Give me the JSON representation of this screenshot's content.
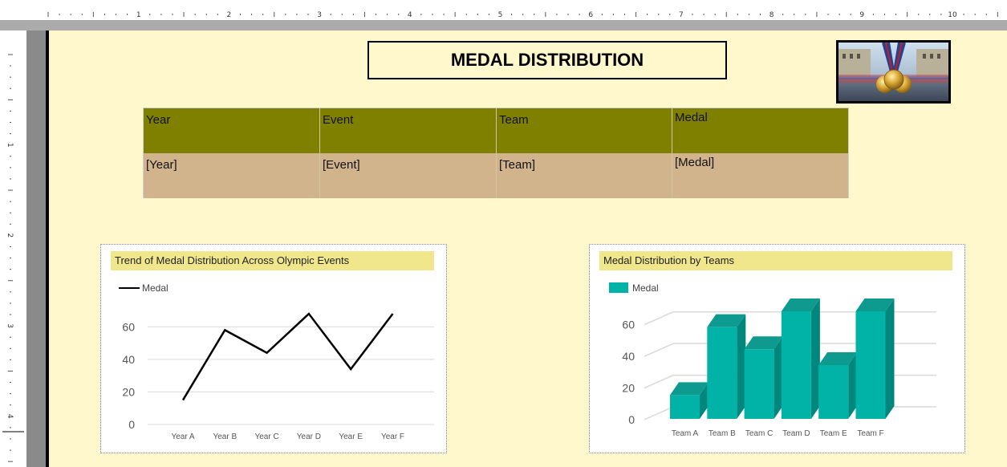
{
  "report": {
    "title": "MEDAL DISTRIBUTION"
  },
  "ruler": {
    "top_numbers": [
      "1",
      "2",
      "3",
      "4",
      "5",
      "6",
      "7",
      "8",
      "9",
      "10"
    ],
    "left_numbers": [
      "1",
      "2",
      "3",
      "4"
    ]
  },
  "table": {
    "headers": [
      "Year",
      "Event",
      "Team",
      "Medal"
    ],
    "row": [
      "[Year]",
      "[Event]",
      "[Team]",
      "[Medal]"
    ]
  },
  "colors": {
    "surface": "#fff8cc",
    "header_bg": "#808000",
    "row_bg": "#d2b48c",
    "panel_title_bg": "#f0e68c",
    "bar_face": "#00b3a6",
    "bar_top": "#0f9a8f",
    "bar_side": "#00877d",
    "line": "#000000"
  },
  "chart_data": [
    {
      "type": "line",
      "title": "Trend of Medal Distribution Across Olympic Events",
      "categories": [
        "Year A",
        "Year B",
        "Year C",
        "Year D",
        "Year E",
        "Year F"
      ],
      "series": [
        {
          "name": "Medal",
          "values": [
            15,
            58,
            44,
            68,
            34,
            68
          ]
        }
      ],
      "yticks": [
        0,
        20,
        40,
        60
      ],
      "ylim": [
        0,
        70
      ],
      "grid": true,
      "legend": "top-left"
    },
    {
      "type": "bar",
      "title": "Medal Distribution by Teams",
      "categories": [
        "Team A",
        "Team B",
        "Team C",
        "Team D",
        "Team E",
        "Team F"
      ],
      "series": [
        {
          "name": "Medal",
          "values": [
            15,
            58,
            44,
            68,
            34,
            68
          ]
        }
      ],
      "yticks": [
        0,
        20,
        40,
        60
      ],
      "ylim": [
        0,
        70
      ],
      "grid": true,
      "legend": "top-left",
      "style": "3d"
    }
  ]
}
